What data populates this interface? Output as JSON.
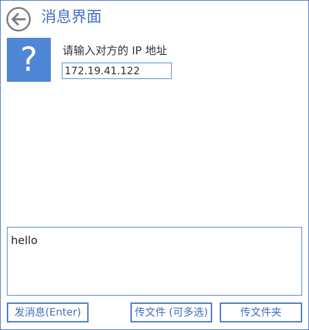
{
  "header": {
    "back_icon": "arrow-left-circle-icon",
    "title": "消息界面"
  },
  "ip_section": {
    "icon_glyph": "?",
    "icon_name": "question-mark-icon",
    "label": "请输入对方的 IP 地址",
    "value": "172.19.41.122"
  },
  "message": {
    "value": "hello"
  },
  "actions": {
    "send_label": "发消息(Enter)",
    "send_files_label": "传文件 (可多选)",
    "send_folder_label": "传文件夹"
  },
  "colors": {
    "accent": "#3f6fbf",
    "border": "#4a7bc4",
    "tile": "#4f86d6"
  }
}
